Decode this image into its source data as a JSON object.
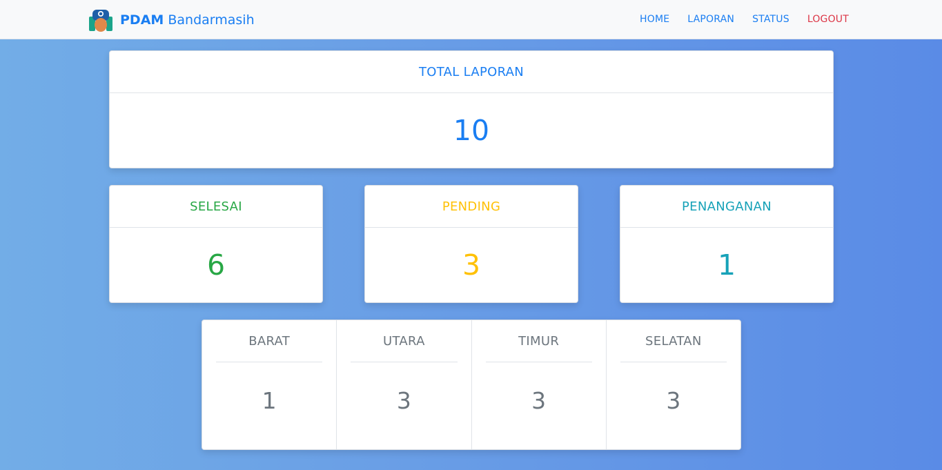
{
  "navbar": {
    "brand_bold": "PDAM",
    "brand_rest": " Bandarmasih",
    "logo_icon": "pdam-logo-icon",
    "links": [
      {
        "label": "HOME"
      },
      {
        "label": "LAPORAN"
      },
      {
        "label": "STATUS"
      },
      {
        "label": "LOGOUT"
      }
    ]
  },
  "total": {
    "title": "TOTAL LAPORAN",
    "value": "10"
  },
  "status": {
    "selesai": {
      "title": "SELESAI",
      "value": "6"
    },
    "pending": {
      "title": "PENDING",
      "value": "3"
    },
    "penanganan": {
      "title": "PENANGANAN",
      "value": "1"
    }
  },
  "regions": [
    {
      "title": "BARAT",
      "value": "1"
    },
    {
      "title": "UTARA",
      "value": "3"
    },
    {
      "title": "TIMUR",
      "value": "3"
    },
    {
      "title": "SELATAN",
      "value": "3"
    }
  ],
  "colors": {
    "primary": "#1a7ef2",
    "success": "#28a745",
    "warning": "#ffc107",
    "info": "#17a2b8",
    "danger": "#dc3545",
    "muted": "#6c757d"
  }
}
